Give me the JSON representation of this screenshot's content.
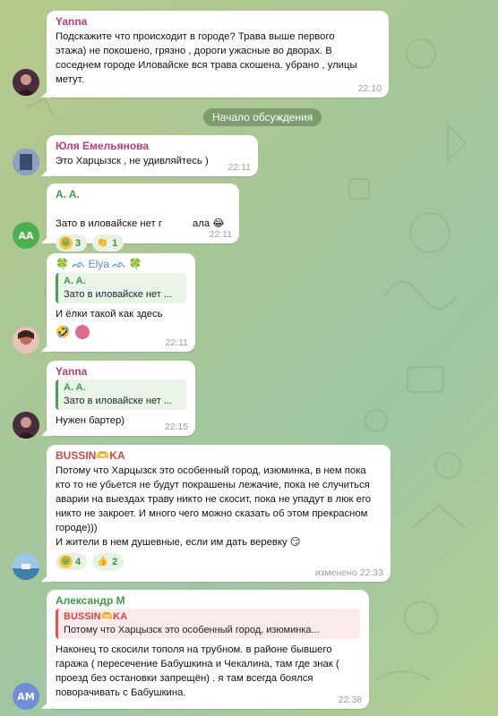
{
  "divider": "Начало обсуждения",
  "messages": [
    {
      "sender": "Yanna",
      "sender_color": "#c0397a",
      "text": "Подскажите что происходит в городе? Трава выше первого этажа) не покошено, грязно , дороги ужасные во дворах. В соседнем городе Иловайске  вся трава скошена. убрано , улицы метут.",
      "time": "22:10"
    },
    {
      "sender": "Юля Емельянова",
      "sender_color": "#c0397a",
      "text": "Это Харцызск , не удивляйтесь )",
      "time": "22:11"
    },
    {
      "sender": "A. A.",
      "sender_color": "#3d9b4a",
      "avatar_initials": "AA",
      "text": "Зато в иловайске нет г",
      "text_tail": "ала",
      "reactions": [
        {
          "icon": "grin-icon",
          "count": "3"
        },
        {
          "icon": "clap-icon",
          "count": "1"
        }
      ],
      "time": "22:11"
    },
    {
      "sender": "Elya",
      "sender_color": "#3d9b4a",
      "reply_name": "A. A.",
      "reply_text": "Зато в иловайске нет ...",
      "text": "И ёлки такой как здесь",
      "time": "22:11"
    },
    {
      "sender": "Yanna",
      "sender_color": "#c0397a",
      "reply_name": "A. A.",
      "reply_text": "Зато в иловайске нет ...",
      "text": "Нужен бартер)",
      "time": "22:15"
    },
    {
      "sender": "BUSSIN",
      "sender_suffix": "KA",
      "sender_color": "#d9453f",
      "text": "Потому что Харцызск это особенный город,  изюминка, в нем пока кто то не убьется не будут покрашены лежачие, пока не случиться аварии на выездах траву никто не скосит, пока не упадут в люк его никто не закроет. И много чего можно сказать об этом прекрасном городе)))\nИ жители в нем душевные, если им дать веревку",
      "reactions": [
        {
          "icon": "grin-icon",
          "count": "4"
        },
        {
          "icon": "thumbs-up-icon",
          "count": "2"
        }
      ],
      "time": "изменено 22:33"
    },
    {
      "sender": "Александр М",
      "sender_color": "#3d9b4a",
      "avatar_initials": "AM",
      "reply_name": "BUSSIN",
      "reply_suffix": "KA",
      "reply_text": "Потому что Харцызск это особенный город,  изюминка...",
      "text": "Наконец то скосили тополя на трубном. в районе бывшего гаража ( пересечение Бабушкина и Чекалина, там где знак ( проезд без остановки запрещён) . я там всегда боялся поворачивать с Бабушкина.",
      "time": "22:38"
    }
  ]
}
